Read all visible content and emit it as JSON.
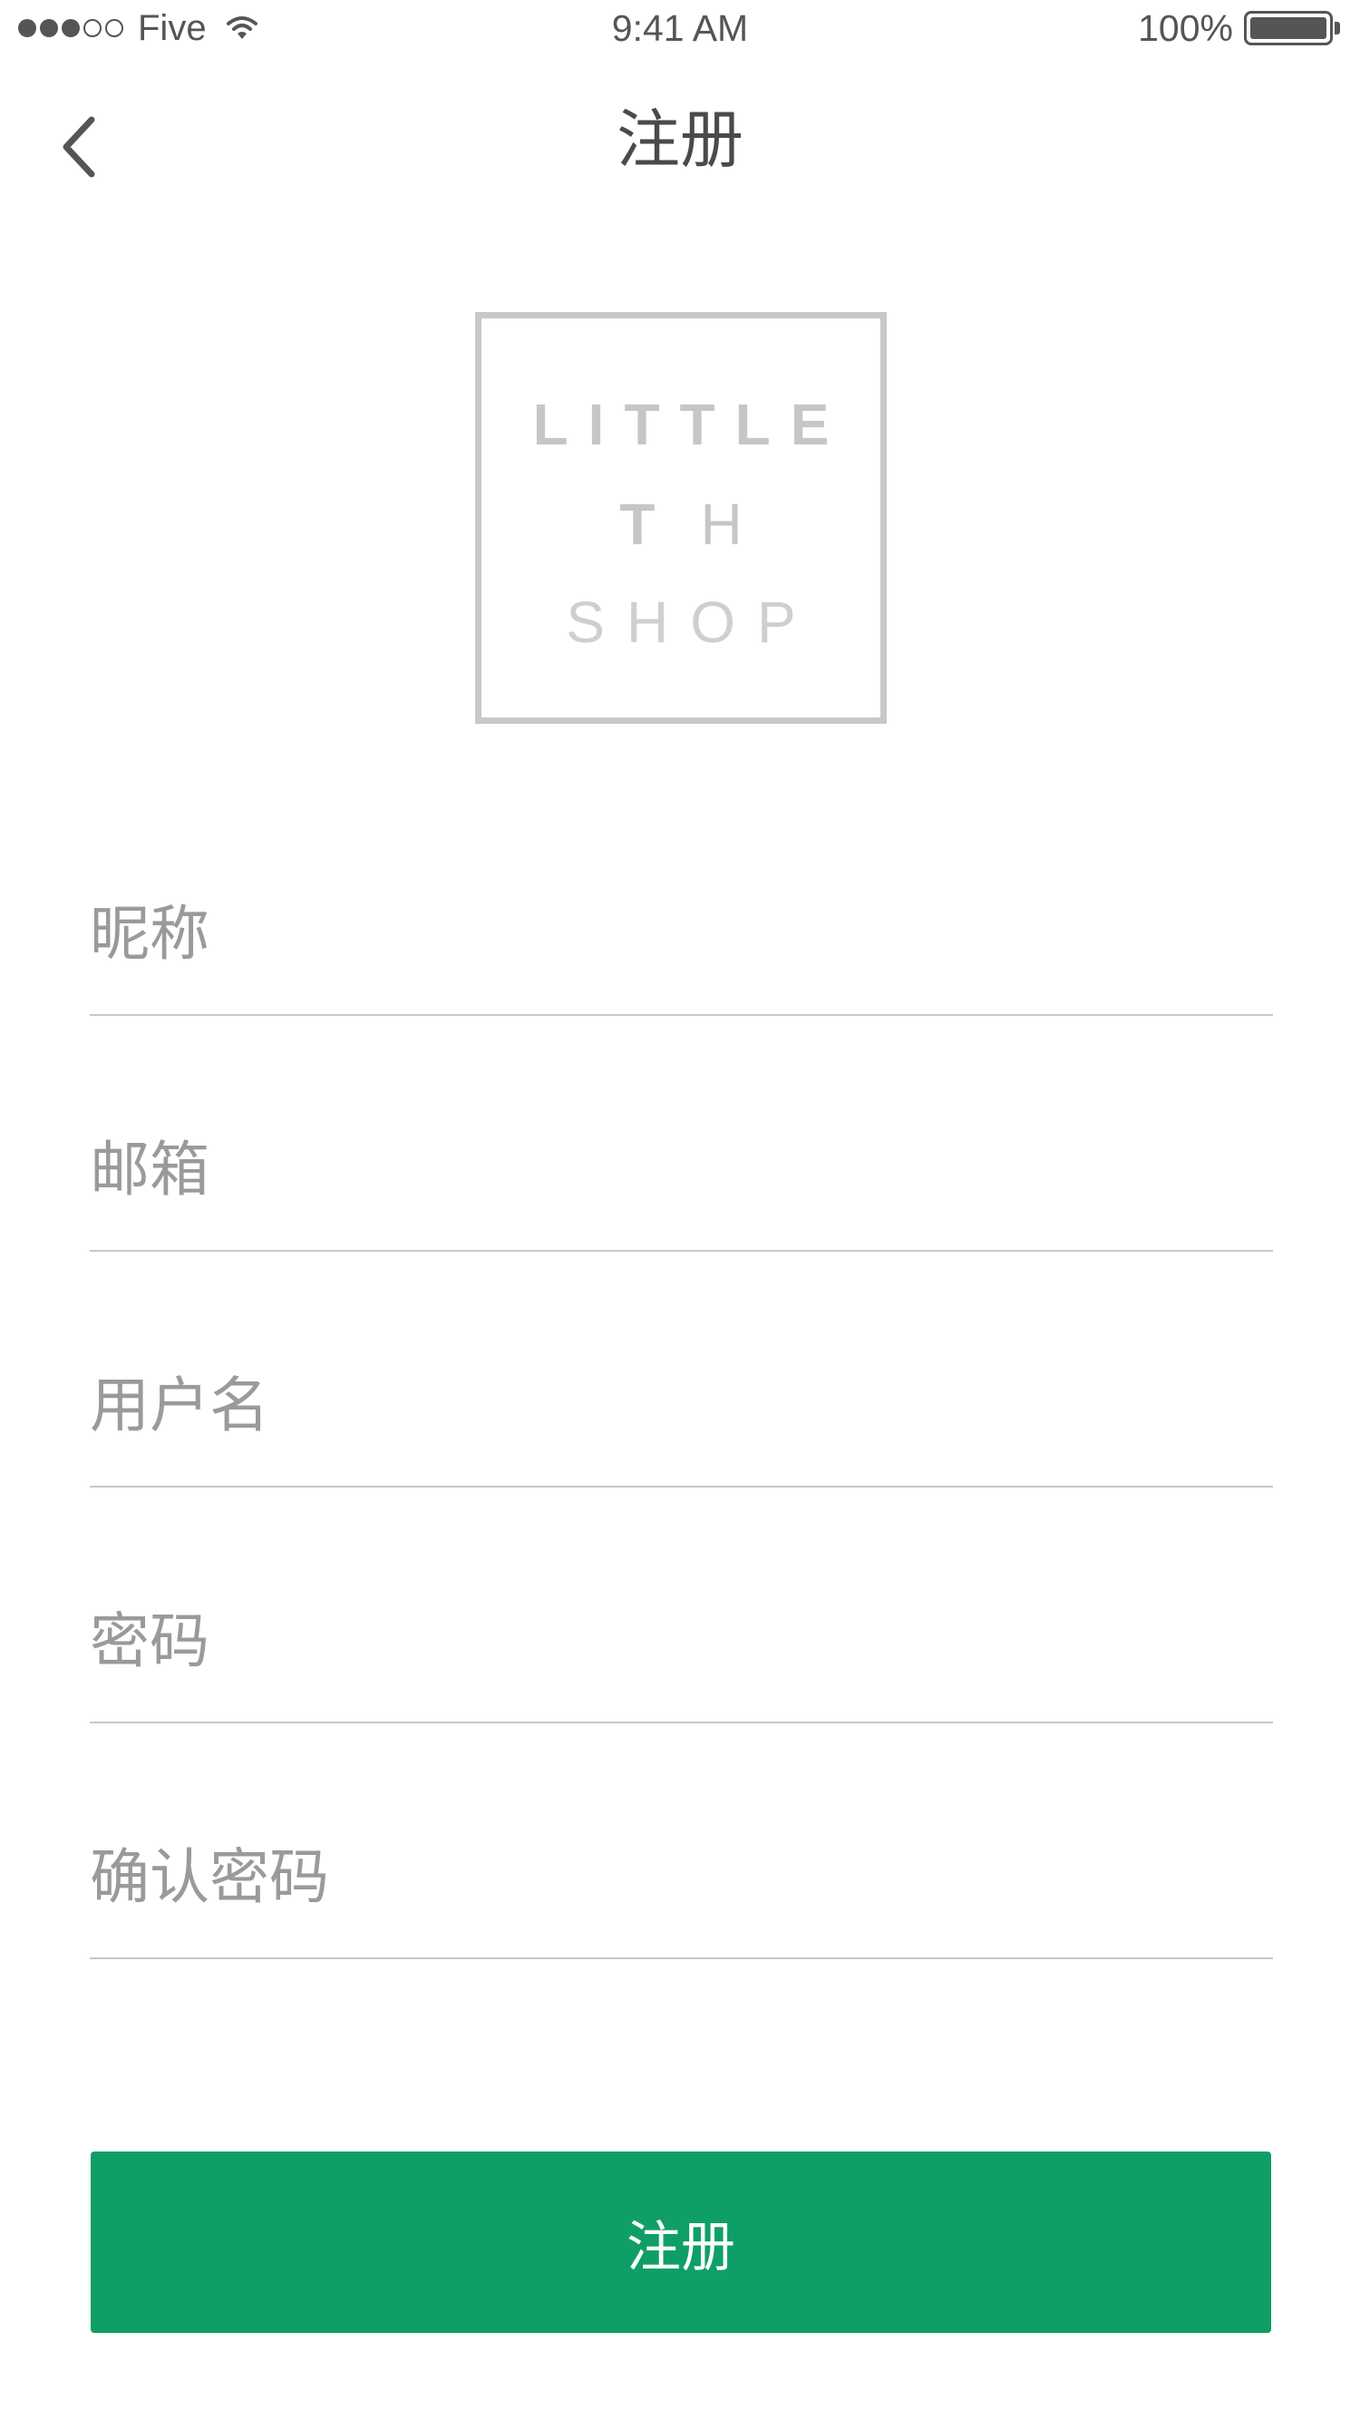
{
  "status_bar": {
    "carrier": "Five",
    "time": "9:41 AM",
    "battery": "100%",
    "battery_level": 1.0,
    "signal_bars": 3,
    "signal_total": 5
  },
  "nav": {
    "title": "注册",
    "back_icon": "chevron-left-icon"
  },
  "logo": {
    "line1": "LITTLE",
    "line2_a": "T",
    "line2_b": "H",
    "line3": "SHOP"
  },
  "form": {
    "nickname_placeholder": "昵称",
    "email_placeholder": "邮箱",
    "username_placeholder": "用户名",
    "password_placeholder": "密码",
    "confirm_password_placeholder": "确认密码",
    "submit_label": "注册"
  },
  "colors": {
    "accent": "#0f9f66",
    "text": "#4a4a4a",
    "placeholder": "#9a9a9a",
    "divider": "#c8c8c8"
  }
}
